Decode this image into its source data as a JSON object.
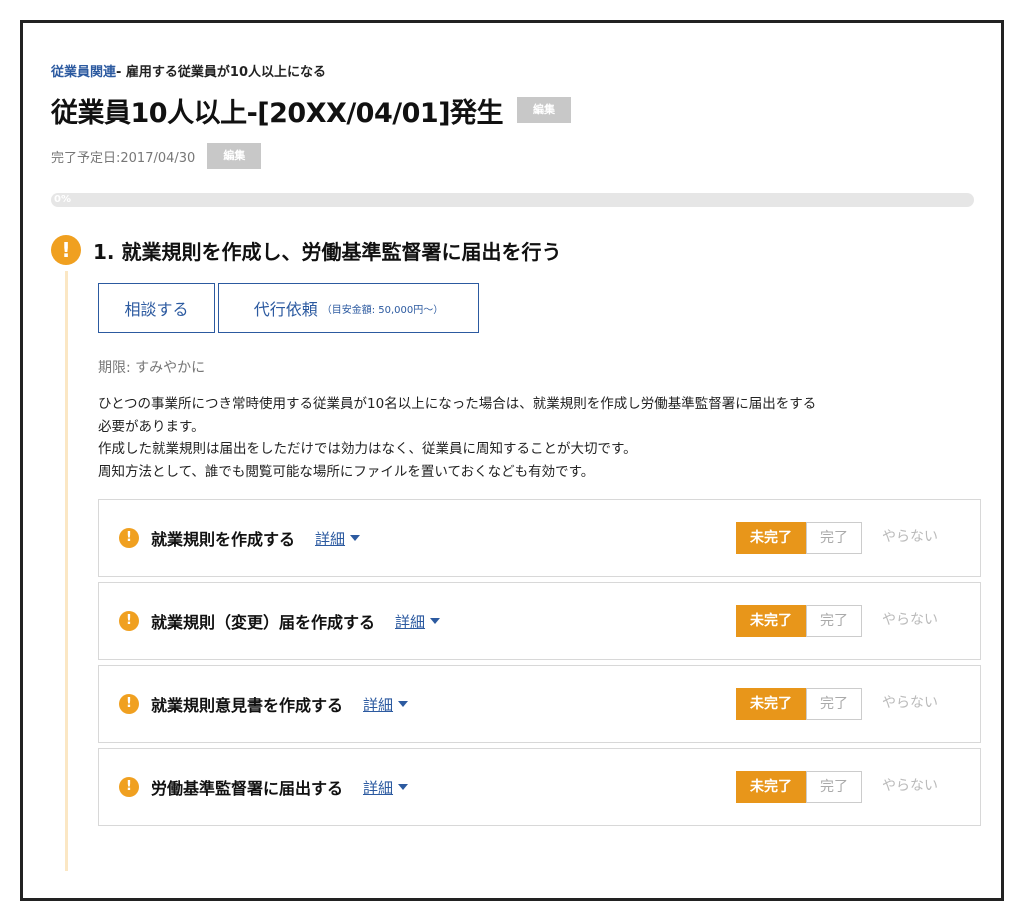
{
  "breadcrumb": {
    "link": "従業員関連",
    "rest": "- 雇用する従業員が10人以上になる"
  },
  "header": {
    "title": "従業員10人以上-[20XX/04/01]発生",
    "edit_label": "編集"
  },
  "due": {
    "text": "完了予定日:2017/04/30",
    "edit_label": "編集"
  },
  "progress": {
    "label": "0%",
    "value": 0
  },
  "section": {
    "title": "1. 就業規則を作成し、労働基準監督署に届出を行う",
    "consult_label": "相談する",
    "proxy_label": "代行依頼",
    "proxy_sub": "（目安金額: 50,000円〜）",
    "deadline": "期限: すみやかに",
    "description": [
      "ひとつの事業所につき常時使用する従業員が10名以上になった場合は、就業規則を作成し労働基準監督署に届出をする",
      "必要があります。",
      "作成した就業規則は届出をしただけでは効力はなく、従業員に周知することが大切です。",
      "周知方法として、誰でも閲覧可能な場所にファイルを置いておくなども有効です。"
    ]
  },
  "tasks": [
    {
      "label": "就業規則を作成する",
      "detail": "詳細",
      "incomplete": "未完了",
      "complete": "完了",
      "skip": "やらない"
    },
    {
      "label": "就業規則（変更）届を作成する",
      "detail": "詳細",
      "incomplete": "未完了",
      "complete": "完了",
      "skip": "やらない"
    },
    {
      "label": "就業規則意見書を作成する",
      "detail": "詳細",
      "incomplete": "未完了",
      "complete": "完了",
      "skip": "やらない"
    },
    {
      "label": "労働基準監督署に届出する",
      "detail": "詳細",
      "incomplete": "未完了",
      "complete": "完了",
      "skip": "やらない"
    }
  ],
  "colors": {
    "accent": "#e8961a",
    "link": "#2c5aa0",
    "edit_bg": "#c8c8c8",
    "progress_track": "#e6e6e6"
  },
  "icons": {
    "warning": "exclamation-circle-icon",
    "detail": "caret-down-icon"
  }
}
